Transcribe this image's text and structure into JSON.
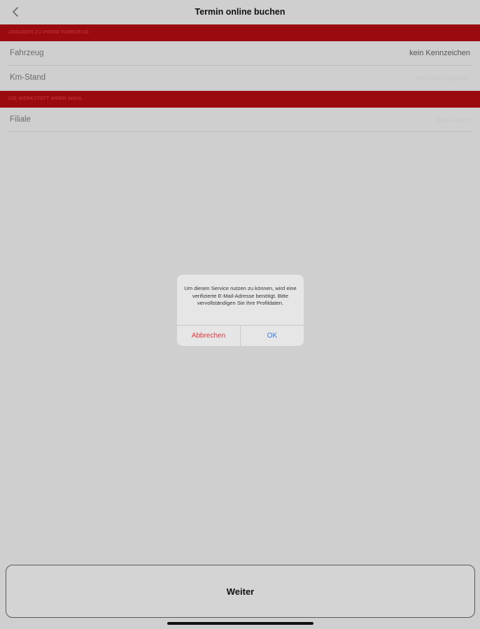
{
  "nav": {
    "title": "Termin online buchen",
    "back_icon": "chevron-left-icon"
  },
  "sections": [
    {
      "header": "Angaben zu Ihrem Fahrzeug"
    },
    {
      "header": "Die Werkstatt Ihrer Wahl"
    }
  ],
  "rows": {
    "fahrzeug": {
      "label": "Fahrzeug",
      "value": "kein Kennzeichen"
    },
    "kmstand": {
      "label": "Km-Stand",
      "placeholder": "Km-Stand angeben"
    },
    "filiale": {
      "label": "Filiale",
      "placeholder": "Bitte wählen"
    }
  },
  "dialog": {
    "message": "Um diesen Service nutzen zu können, wird eine verifizierte E-Mail-Adresse benötigt. Bitte vervollständigen Sie ihre Profildaten.",
    "cancel_label": "Abbrechen",
    "ok_label": "OK"
  },
  "footer": {
    "weiter_label": "Weiter"
  },
  "colors": {
    "background": "#cfcfcf",
    "section_header": "#9a0b10",
    "cancel": "#d9373d",
    "ok": "#3a7bd5"
  }
}
